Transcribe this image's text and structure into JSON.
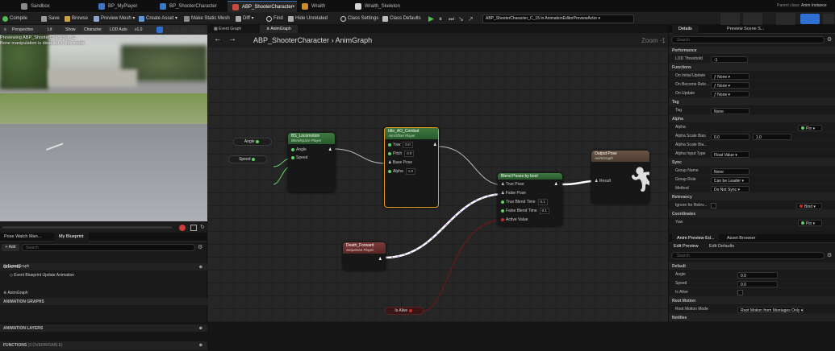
{
  "tabs": [
    {
      "label": "Sandbox",
      "color": "#8a8a8a"
    },
    {
      "label": "BP_MyPlayer",
      "color": "#3d78c4"
    },
    {
      "label": "BP_ShooterCharacter",
      "color": "#3d78c4"
    },
    {
      "label": "ABP_ShooterCharacter•",
      "color": "#c44b3d",
      "active": true
    },
    {
      "label": "Wraith",
      "color": "#c78c2d"
    },
    {
      "label": "Wraith_Skeleton",
      "color": "#d6d6d6"
    }
  ],
  "parent_class": {
    "label": "Parent class:",
    "value": "Anim Instance"
  },
  "toolbar": {
    "compile": "Compile",
    "save": "Save",
    "browse": "Browse",
    "preview_mesh": "Preview Mesh ▾",
    "create_asset": "Create Asset ▾",
    "make_static_mesh": "Make Static Mesh",
    "diff": "Diff ▾",
    "find": "Find",
    "hide_unrelated": "Hide Unrelated",
    "class_settings": "Class Settings",
    "class_defaults": "Class Defaults",
    "debug_object": "ABP_ShooterCharacter_C_15 in AnimationEditorPreviewActor"
  },
  "viewport": {
    "buttons": [
      "Perspective",
      "Lit",
      "Show",
      "Character",
      "LOD Auto",
      "x1.0"
    ],
    "msg1": "Previewing ABP_ShooterCharacter_C.",
    "msg2": "Bone manipulation is disabled in this mode."
  },
  "mybp": {
    "tab_pose": "Pose Watch Man...",
    "tab_mybp": "My Blueprint",
    "add": "+ Add",
    "search_placeholder": "Search",
    "graphs": "GRAPHS",
    "eventgraph": "EventGraph",
    "event_update": "Event Blueprint Update Animation",
    "anim_graphs": "ANIMATION GRAPHS",
    "animgraph": "AnimGraph",
    "anim_layers": "ANIMATION LAYERS",
    "functions": "FUNCTIONS",
    "functions_note": "(3 OVERRIDABLE)"
  },
  "graph": {
    "tab_event": "Event Graph",
    "tab_anim": "AnimGraph",
    "breadcrumb_root": "ABP_ShooterCharacter",
    "breadcrumb_sep": "›",
    "breadcrumb_leaf": "AnimGraph",
    "zoom": "Zoom -1",
    "var_angle": "Angle",
    "var_speed": "Speed",
    "bs": {
      "title": "BS_Locomotion",
      "sub": "Blendspace Player",
      "angle": "Angle",
      "speed": "Speed"
    },
    "idle": {
      "title": "Idle_AO_Combat",
      "sub": "AimOffset Player",
      "yaw": "Yaw",
      "yaw_val": "0.0",
      "pitch": "Pitch",
      "pitch_val": "0.0",
      "base_pose": "Base Pose",
      "alpha": "Alpha",
      "alpha_val": "1.0"
    },
    "output": {
      "title": "Output Pose",
      "sub": "AnimGraph",
      "result": "Result"
    },
    "blend": {
      "title": "Blend Poses by bool",
      "true_pose": "True Pose",
      "false_pose": "False Pose",
      "true_time": "True Blend Time",
      "true_time_val": "0.1",
      "false_time": "False Blend Time",
      "false_time_val": "0.1",
      "active": "Active Value"
    },
    "death": {
      "title": "Death_Forward",
      "sub": "Sequence Player"
    },
    "is_alive": "Is Alive"
  },
  "details": {
    "tab_details": "Details",
    "tab_preview": "Preview Scene S...",
    "search_placeholder": "Search",
    "performance": "Performance",
    "lod_threshold": "LOD Threshold",
    "lod_val": "-1",
    "functions": "Functions",
    "on_initial": "On Initial Update",
    "on_become": "On Become Rele...",
    "on_update": "On Update",
    "none": "None",
    "tag": "Tag",
    "tag_label": "Tag",
    "tag_val": "None",
    "alpha": "Alpha",
    "alpha_label": "Alpha",
    "pin": "Pin",
    "scale_bias": "Alpha Scale Bias",
    "sb_min": "0.0",
    "sb_max": "1.0",
    "scale_bias_clamp": "Alpha Scale Bia...",
    "alpha_input": "Alpha Input Type",
    "alpha_input_val": "Float Value",
    "sync": "Sync",
    "group_name": "Group Name",
    "group_name_val": "None",
    "group_role": "Group Role",
    "group_role_val": "Can be Leader",
    "method": "Method",
    "method_val": "Do Not Sync",
    "relevancy": "Relevancy",
    "ignore": "Ignore for Relev...",
    "bind": "Bind",
    "coordinates": "Coordinates",
    "yaw": "Yaw"
  },
  "preview": {
    "tab_edit": "Anim Preview Ed...",
    "tab_asset": "Asset Browser",
    "edit_preview": "Edit Preview",
    "edit_defaults": "Edit Defaults",
    "search_placeholder": "Search",
    "default": "Default",
    "angle": "Angle",
    "angle_val": "0.0",
    "speed": "Speed",
    "speed_val": "0.0",
    "is_alive": "Is Alive",
    "root_motion": "Root Motion",
    "root_mode": "Root Motion Mode",
    "root_mode_val": "Root Motion from Montages Only",
    "notifies": "Notifies"
  }
}
